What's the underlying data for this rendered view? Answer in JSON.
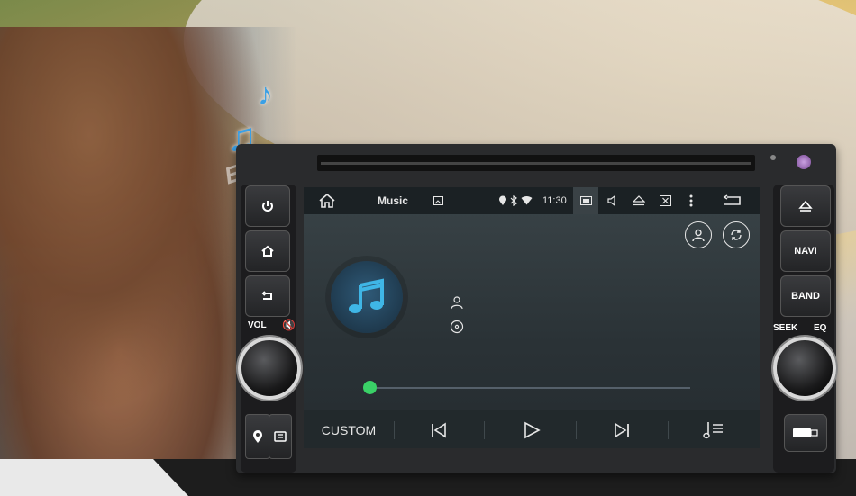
{
  "brand": {
    "watermark": "Eunavi"
  },
  "screen": {
    "status": {
      "app_title": "Music",
      "clock": "11:30"
    },
    "player": {
      "progress": 0,
      "mode_label": "CUSTOM"
    }
  },
  "left_panel": {
    "vol_label": "VOL"
  },
  "right_panel": {
    "navi_label": "NAVI",
    "band_label": "BAND",
    "seek_label": "SEEK",
    "eq_label": "EQ"
  },
  "colors": {
    "accent_progress": "#3ad167",
    "screen_bg": "#2a3236",
    "note_icon": "#3fb6e6"
  },
  "icons": [
    "home-icon",
    "image-icon",
    "location-icon",
    "bluetooth-icon",
    "wifi-icon",
    "screen-icon",
    "volume-icon",
    "eject-icon",
    "close-box-icon",
    "more-icon",
    "back-icon",
    "user-icon",
    "repeat-icon",
    "music-note-icon",
    "artist-icon",
    "album-icon",
    "previous-icon",
    "play-icon",
    "next-icon",
    "playlist-icon",
    "power-icon",
    "mute-icon",
    "gps-icon",
    "sd-card-icon",
    "usb-icon"
  ]
}
